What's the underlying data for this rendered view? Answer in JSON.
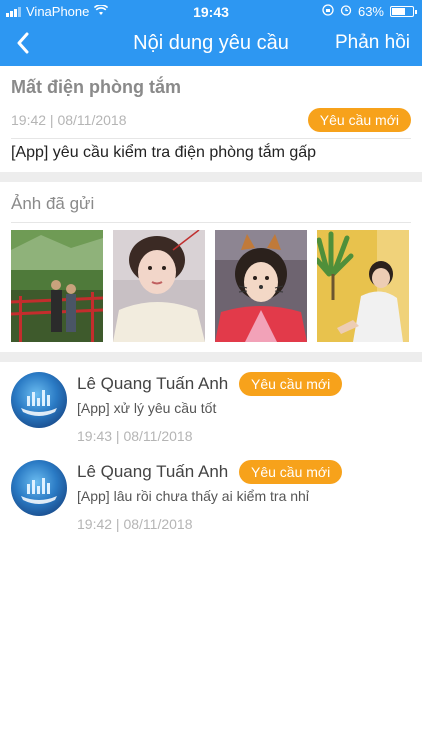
{
  "status": {
    "carrier": "VinaPhone",
    "time": "19:43",
    "battery_text": "63%",
    "battery_level": 0.63
  },
  "nav": {
    "back_icon": "chevron-left-icon",
    "title": "Nội dung yêu cầu",
    "reply_label": "Phản hồi"
  },
  "request": {
    "title": "Mất điện phòng tắm",
    "date": "19:42 | 08/11/2018",
    "status": "Yêu cầu mới",
    "description": "[App] yêu cầu kiểm tra điện phòng tắm gấp"
  },
  "photos": {
    "title": "Ảnh đã gửi"
  },
  "comments": [
    {
      "name": "Lê Quang Tuấn Anh",
      "status": "Yêu cầu mới",
      "text": "[App] xử lý yêu cầu tốt",
      "date": "19:43 | 08/11/2018"
    },
    {
      "name": "Lê Quang Tuấn Anh",
      "status": "Yêu cầu mới",
      "text": "[App] lâu rồi chưa thấy ai kiểm tra nhỉ",
      "date": "19:42 | 08/11/2018"
    }
  ],
  "colors": {
    "header": "#2d97f2",
    "badge": "#f7a21b"
  }
}
